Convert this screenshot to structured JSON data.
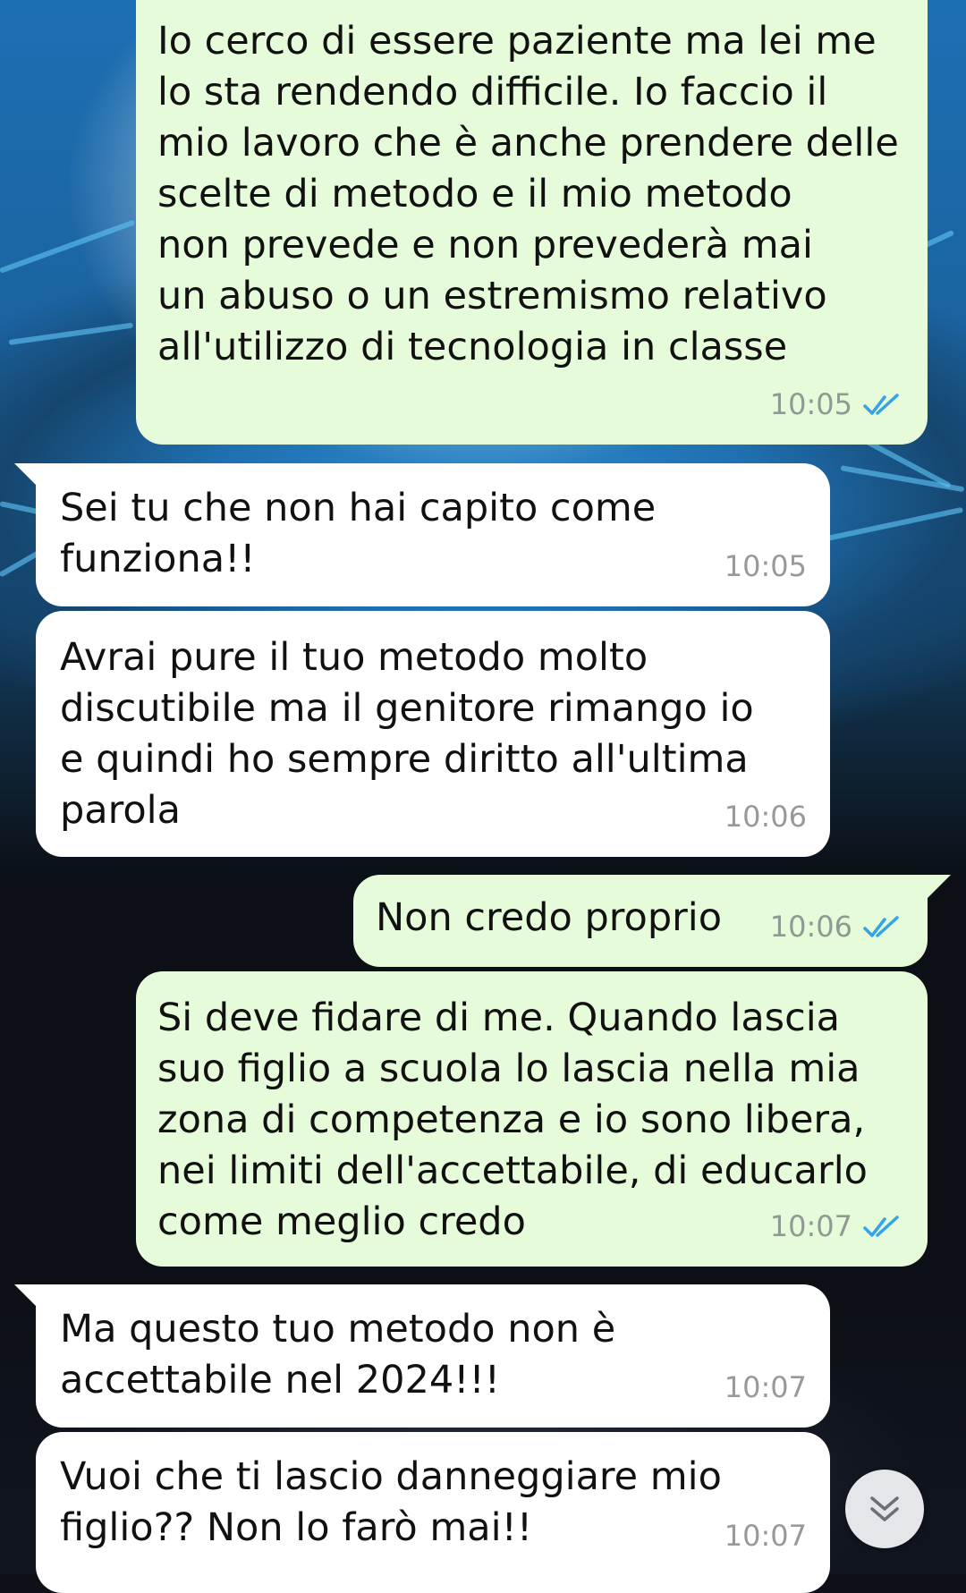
{
  "chat": {
    "messages": [
      {
        "direction": "out",
        "text": "Io cerco di essere paziente ma lei me\nlo sta rendendo difficile. Io faccio il\nmio lavoro che è anche prendere delle\nscelte di metodo e il mio metodo\nnon prevede e non prevederà mai\nun abuso o un estremismo relativo\nall'utilizzo di tecnologia in classe",
        "time": "10:05",
        "status": "read"
      },
      {
        "direction": "in",
        "text": "Sei tu che non hai capito come\nfunziona!!",
        "time": "10:05"
      },
      {
        "direction": "in",
        "text": "Avrai pure il tuo metodo molto\ndiscutibile ma il genitore rimango io\ne quindi ho sempre diritto all'ultima\nparola",
        "time": "10:06"
      },
      {
        "direction": "out",
        "text": "Non credo proprio",
        "time": "10:06",
        "status": "read"
      },
      {
        "direction": "out",
        "text": "Si deve fidare di me. Quando lascia\nsuo figlio a scuola lo lascia nella mia\nzona di competenza e io sono libera,\nnei limiti dell'accettabile, di educarlo\ncome meglio credo",
        "time": "10:07",
        "status": "read"
      },
      {
        "direction": "in",
        "text": "Ma questo tuo metodo non è\naccettabile nel 2024!!!",
        "time": "10:07"
      },
      {
        "direction": "in",
        "text": "Vuoi che ti lascio danneggiare mio\nfiglio?? Non lo farò mai!!",
        "time": "10:07"
      }
    ]
  },
  "icons": {
    "read_receipt": "double-check-icon",
    "scroll_down": "chevron-double-down-icon"
  },
  "colors": {
    "outgoing_bubble": "#e6fbd9",
    "incoming_bubble": "#ffffff",
    "read_tick": "#34a4e8"
  }
}
